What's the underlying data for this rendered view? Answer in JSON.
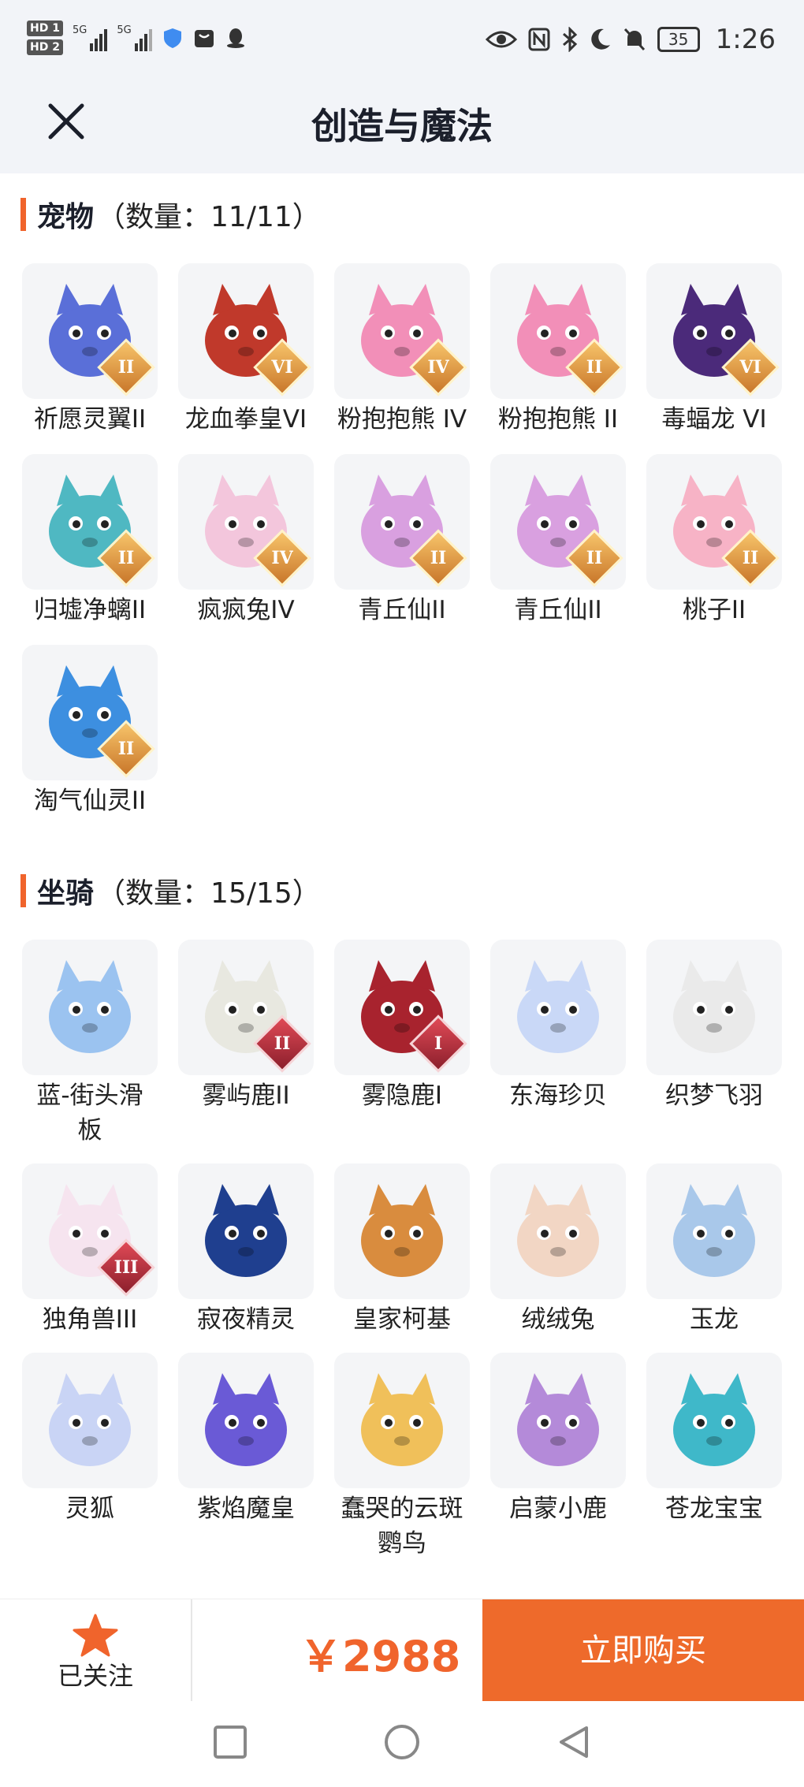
{
  "status_bar": {
    "hd1": "HD 1",
    "hd2": "HD 2",
    "net1": "5G",
    "net2": "5G",
    "battery": "35",
    "time": "1:26"
  },
  "header": {
    "title": "创造与魔法",
    "close_icon": "close-icon"
  },
  "pets": {
    "section_name": "宠物",
    "section_count": "（数量：11/11）",
    "items": [
      {
        "label": "祈愿灵翼II",
        "rank": "II",
        "rank_style": "gold",
        "color": "#5a6fd8"
      },
      {
        "label": "龙血拳皇VI",
        "rank": "VI",
        "rank_style": "gold",
        "color": "#c0392b"
      },
      {
        "label": "粉抱抱熊 IV",
        "rank": "IV",
        "rank_style": "gold",
        "color": "#f28fb8"
      },
      {
        "label": "粉抱抱熊 II",
        "rank": "II",
        "rank_style": "gold",
        "color": "#f28fb8"
      },
      {
        "label": "毒蝠龙 VI",
        "rank": "VI",
        "rank_style": "gold",
        "color": "#4b2a7a"
      },
      {
        "label": "归墟净螭II",
        "rank": "II",
        "rank_style": "gold",
        "color": "#4fb8c2"
      },
      {
        "label": "疯疯兔IV",
        "rank": "IV",
        "rank_style": "gold",
        "color": "#f3c6dc"
      },
      {
        "label": "青丘仙II",
        "rank": "II",
        "rank_style": "gold",
        "color": "#d9a0e0"
      },
      {
        "label": "青丘仙II",
        "rank": "II",
        "rank_style": "gold",
        "color": "#d9a0e0"
      },
      {
        "label": "桃子II",
        "rank": "II",
        "rank_style": "gold",
        "color": "#f7b3c6"
      },
      {
        "label": "淘气仙灵II",
        "rank": "II",
        "rank_style": "gold",
        "color": "#3d8fe0"
      }
    ]
  },
  "mounts": {
    "section_name": "坐骑",
    "section_count": "（数量：15/15）",
    "items": [
      {
        "label": "蓝-街头滑\n板",
        "rank": "",
        "color": "#9bc3f0"
      },
      {
        "label": "雾屿鹿II",
        "rank": "II",
        "rank_style": "red",
        "color": "#e8e8e0"
      },
      {
        "label": "雾隐鹿I",
        "rank": "I",
        "rank_style": "red",
        "color": "#a8232e"
      },
      {
        "label": "东海珍贝",
        "rank": "",
        "color": "#c9d8f7"
      },
      {
        "label": "织梦飞羽",
        "rank": "",
        "color": "#eaeaea"
      },
      {
        "label": "独角兽III",
        "rank": "III",
        "rank_style": "red",
        "color": "#f6e4ef"
      },
      {
        "label": "寂夜精灵",
        "rank": "",
        "color": "#1f3f8f"
      },
      {
        "label": "皇家柯基",
        "rank": "",
        "color": "#d98c3e"
      },
      {
        "label": "绒绒兔",
        "rank": "",
        "color": "#f2d6c4"
      },
      {
        "label": "玉龙",
        "rank": "",
        "color": "#a9c8ea"
      },
      {
        "label": "灵狐",
        "rank": "",
        "color": "#c9d4f5"
      },
      {
        "label": "紫焰魔皇",
        "rank": "",
        "color": "#6a5ad6"
      },
      {
        "label": "蠢哭的云斑\n鹦鸟",
        "rank": "",
        "color": "#f0c05a"
      },
      {
        "label": "启蒙小鹿",
        "rank": "",
        "color": "#b48ad9"
      },
      {
        "label": "苍龙宝宝",
        "rank": "",
        "color": "#3fb8c9"
      }
    ]
  },
  "bottom_bar": {
    "follow_label": "已关注",
    "price": "￥2988",
    "buy_label": "立即购买"
  }
}
